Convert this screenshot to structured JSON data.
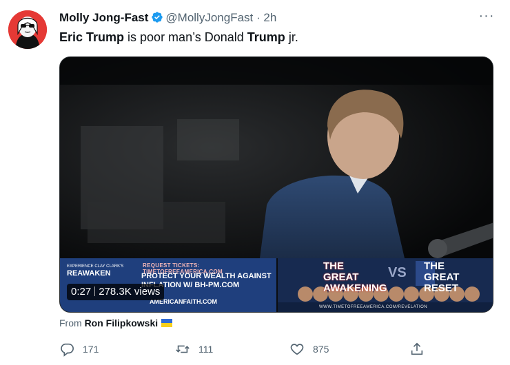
{
  "tweet": {
    "author_name": "Molly Jong-Fast",
    "handle": "@MollyJongFast",
    "separator": "·",
    "time": "2h",
    "more_icon": "more-horizontal-icon",
    "text_parts": [
      "Eric Trump",
      " is poor man’s Donald ",
      "Trump",
      " jr."
    ]
  },
  "video": {
    "duration": "0:27",
    "views": "278.3K views",
    "ad": {
      "event_line1": "EXPERIENCE CLAY CLARK'S",
      "event_line2": "REAWAKEN",
      "tickets": "REQUEST TICKETS: TIMETOFREEAMERICA.COM",
      "protect_line1": "PROTECT YOUR WEALTH AGAINST",
      "protect_line2": "INFLATION W/ BH-PM.COM",
      "brand": "AMERICANFAITH.COM",
      "great_awakening": "THE GREAT AWAKENING",
      "vs": "VS",
      "great_reset": "THE GREAT RESET",
      "url": "WWW.TIMETOFREEAMERICA.COM/REVELATION"
    }
  },
  "source": {
    "prefix": "From",
    "name": "Ron Filipkowski",
    "flag_icon": "ukraine-flag-icon"
  },
  "actions": {
    "replies": "171",
    "retweets": "111",
    "likes": "875"
  },
  "colors": {
    "verified": "#1d9bf0",
    "secondary_text": "#536471",
    "avatar_bg": "#e53935"
  }
}
